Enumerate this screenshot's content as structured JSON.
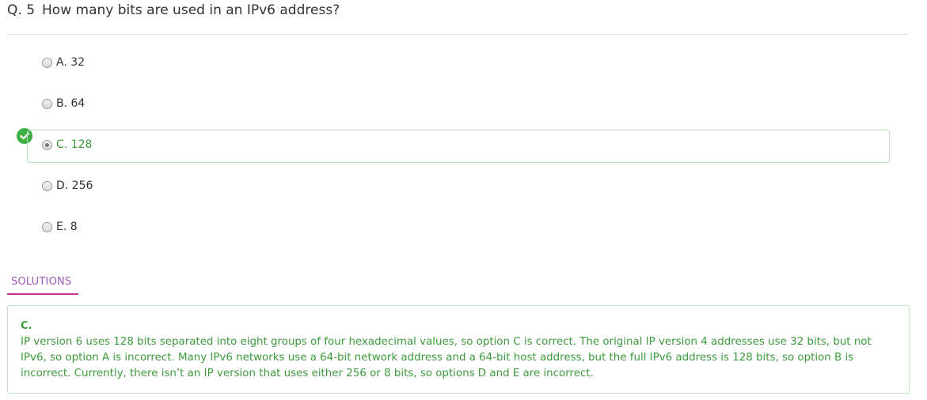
{
  "question": {
    "number": "Q. 5",
    "text": "How many bits are used in an IPv6 address?"
  },
  "options": [
    {
      "label": "A. 32",
      "selected": false,
      "correct": false
    },
    {
      "label": "B. 64",
      "selected": false,
      "correct": false
    },
    {
      "label": "C. 128",
      "selected": true,
      "correct": true
    },
    {
      "label": "D. 256",
      "selected": false,
      "correct": false
    },
    {
      "label": "E. 8",
      "selected": false,
      "correct": false
    }
  ],
  "correct_icon": "check-circle-icon",
  "solutions": {
    "tab_label": "SOLUTIONS",
    "answer": "C.",
    "explanation": "IP version 6 uses 128 bits separated into eight groups of four hexadecimal values, so option C is correct. The original IP version 4 addresses use 32 bits, but not IPv6, so option A is incorrect. Many IPv6 networks use a 64-bit network address and a 64-bit host address, but the full IPv6 address is 128 bits, so option B is incorrect. Currently, there isn’t an IP version that uses either 256 or 8 bits, so options D and E are incorrect."
  },
  "colors": {
    "correct": "#3db043",
    "correct_text": "#3c9a3c",
    "tab_text": "#9b59b6",
    "tab_underline": "#c2358f"
  }
}
